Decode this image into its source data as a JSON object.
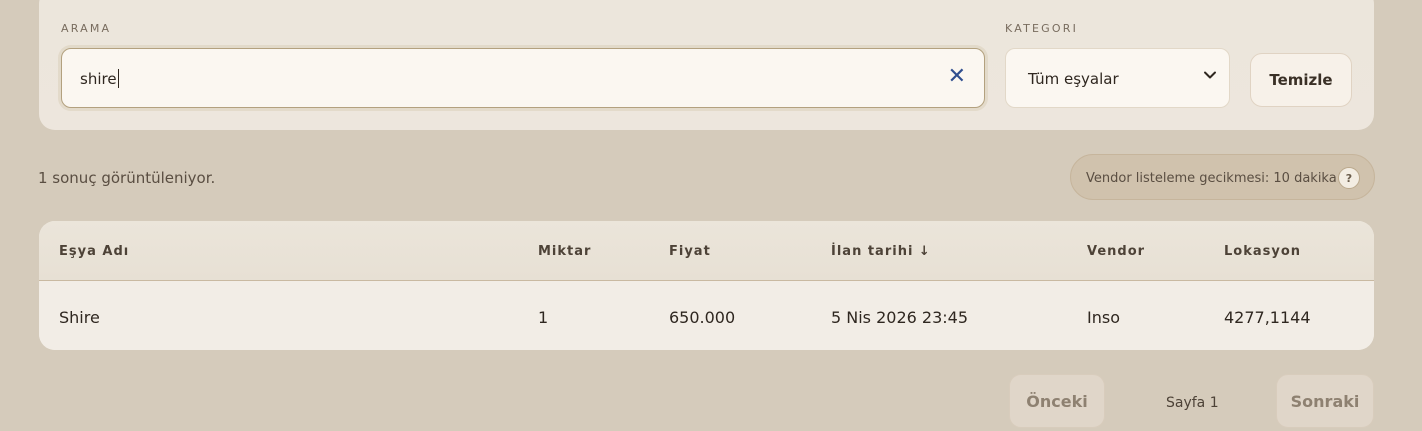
{
  "filters": {
    "search_label": "ARAMA",
    "search_value": "shire",
    "category_label": "KATEGORI",
    "category_selected": "Tüm eşyalar",
    "clear_button": "Temizle"
  },
  "results": {
    "count_text": "1 sonuç görüntüleniyor.",
    "vendor_delay_text": "Vendor listeleme gecikmesi: 10 dakika",
    "help_glyph": "?"
  },
  "table": {
    "columns": [
      "Eşya Adı",
      "Miktar",
      "Fiyat",
      "İlan tarihi ↓",
      "Vendor",
      "Lokasyon"
    ],
    "rows": [
      [
        "Shire",
        "1",
        "650.000",
        "5 Nis 2026 23:45",
        "Inso",
        "4277,1144"
      ]
    ]
  },
  "pagination": {
    "prev": "Önceki",
    "page": "Sayfa 1",
    "next": "Sonraki"
  },
  "icons": {
    "clear_search": "close-icon",
    "category_dropdown": "chevron-down-icon",
    "help": "help-icon"
  },
  "colors": {
    "accent": "#2f4e8f",
    "background": "#d5cbbb",
    "card": "#ece6dc"
  }
}
